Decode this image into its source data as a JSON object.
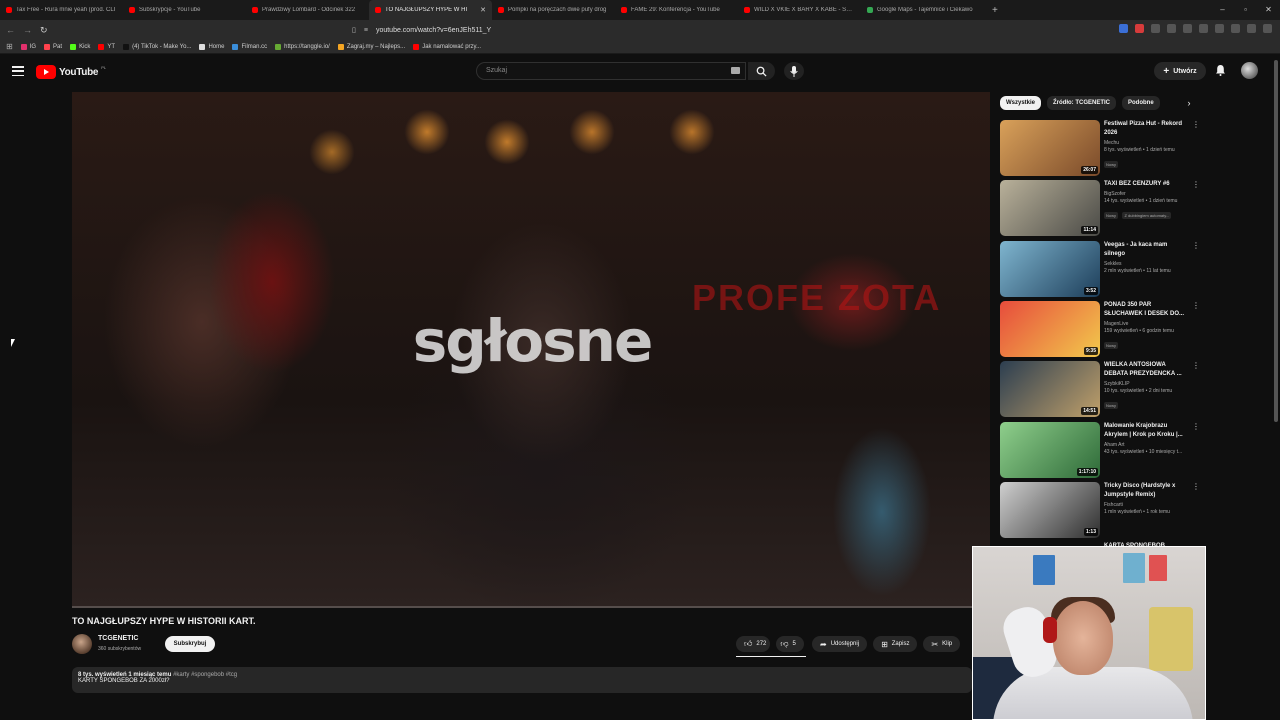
{
  "browser": {
    "tabs": [
      {
        "title": "Tax Free - Rura mnie yeah (prod. CLI",
        "active": false
      },
      {
        "title": "Subskrypcje - YouTube",
        "active": false
      },
      {
        "title": "Prawdziwy Lombard - Odcinek 322",
        "active": false
      },
      {
        "title": "TO NAJGŁUPSZY HYPE W HI",
        "active": true
      },
      {
        "title": "Pompki na poręczach dwie pufy drog",
        "active": false
      },
      {
        "title": "FAME 29: Konferencja - YouTube",
        "active": false
      },
      {
        "title": "WILD X VKIE X BARY X KABE - SZLAI",
        "active": false
      },
      {
        "title": "Google Maps - Tajemnice i Ciekawo",
        "active": false
      }
    ],
    "new_tab": "+",
    "url": "youtube.com/watch?v=6enJEh511_Y",
    "bookmarks": [
      {
        "label": "IG",
        "color": "#e1306c"
      },
      {
        "label": "Pat",
        "color": "#ff424d"
      },
      {
        "label": "Kick",
        "color": "#53fc18"
      },
      {
        "label": "YT",
        "color": "#ff0000"
      },
      {
        "label": "(4) TikTok - Make Yo...",
        "color": "#111111"
      },
      {
        "label": "Home",
        "color": "#dddddd"
      },
      {
        "label": "Filman.cc",
        "color": "#3a8edb"
      },
      {
        "label": "https://tanggle.io/",
        "color": "#66aa33"
      },
      {
        "label": "Zagraj.my – Najleps...",
        "color": "#f5a623"
      },
      {
        "label": "Jak namalować przy...",
        "color": "#ff0000"
      }
    ]
  },
  "youtube": {
    "logo_text": "YouTube",
    "country": "PL",
    "search_placeholder": "Szukaj",
    "create_label": "Utwórz"
  },
  "video": {
    "overlay_text": "sgłosne",
    "progress_fraction": 0.0,
    "title": "TO NAJGŁUPSZY HYPE W HISTORII KART.",
    "channel": "TCGENETIC",
    "subscribers": "360 subskrybentów",
    "subscribe_label": "Subskrybuj",
    "likes": "272",
    "dislikes": "5",
    "share_label": "Udostępnij",
    "save_label": "Zapisz",
    "clip_label": "Klip",
    "desc_meta": "8 tys. wyświetleń  1 miesiąc temu",
    "desc_tags": "#karty #spongebob #tcg",
    "desc_text": "KARTY SPONGEBOB ZA 2000zł?"
  },
  "sidebar": {
    "chips": [
      "Wszystkie",
      "Źródło: TCGENETIC",
      "Podobne"
    ],
    "recommendations": [
      {
        "title": "Festiwal Pizza Hut - Rekord 2026",
        "channel": "Mechu",
        "stats": "8 tys. wyświetleń • 1 dzień temu",
        "badge": "Nowy",
        "duration": "26:07",
        "colors": [
          "#d9a15a",
          "#7a4a2a"
        ]
      },
      {
        "title": "TAXI BEZ CENZURY #6",
        "channel": "BigSzofer",
        "stats": "14 tys. wyświetleń • 1 dzień temu",
        "badge": "Nowy",
        "badge2": "Z dubbingiem automaty...",
        "duration": "11:14",
        "colors": [
          "#b9b19a",
          "#4a4a46"
        ]
      },
      {
        "title": "Veegas - Ja kaca mam silnego",
        "channel": "Sekkles",
        "stats": "2 mln wyświetleń • 11 lat temu",
        "duration": "3:52",
        "colors": [
          "#7fb5cf",
          "#1d3e5a"
        ]
      },
      {
        "title": "PONAD 350 PAR SŁUCHAWEK I DESEK DO...",
        "channel": "MagenLive",
        "stats": "159 wyświetleń • 6 godzin temu",
        "badge": "Nowy",
        "duration": "9:35",
        "colors": [
          "#e74c3c",
          "#f2c94c"
        ]
      },
      {
        "title": "WIELKA ANTOSIOWA DEBATA PREZYDENCKA ...",
        "channel": "SzybkiKLIP",
        "stats": "10 tys. wyświetleń • 2 dni temu",
        "badge": "Nowy",
        "duration": "14:51",
        "colors": [
          "#2c3e50",
          "#c0a06a"
        ]
      },
      {
        "title": "Malowanie Krajobrazu Akrylem | Krok po Kroku |...",
        "channel": "Aham Art",
        "stats": "43 tys. wyświetleń • 10 miesięcy t...",
        "duration": "1:17:10",
        "colors": [
          "#8fcf8c",
          "#2e6a38"
        ]
      },
      {
        "title": "Tricky Disco (Hardstyle x Jumpstyle Remix)",
        "channel": "Fishcarti",
        "stats": "1 mln wyświetleń • 1 rok temu",
        "duration": "1:13",
        "colors": [
          "#cfcfcf",
          "#2e2e2e"
        ]
      }
    ],
    "partial_title": "KARTA SPONGEBOB"
  }
}
